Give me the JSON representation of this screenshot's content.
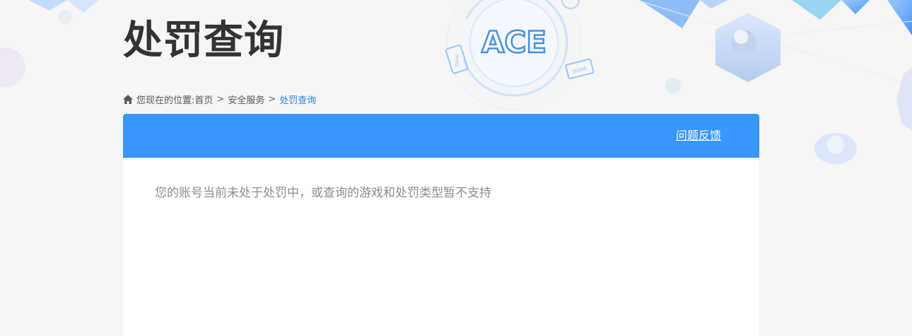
{
  "page": {
    "title": "处罚查询"
  },
  "breadcrumb": {
    "prefix": "您现在的位置:",
    "items": [
      "首页",
      "安全服务"
    ],
    "separator": ">",
    "current": "处罚查询",
    "icon": "home-icon"
  },
  "panel": {
    "feedback_label": "问题反馈",
    "message": "您的账号当前未处于处罚中，或查询的游戏和处罚类型暂不支持"
  },
  "decor": {
    "logo_text": "ACE",
    "device_label_phone": "GAME",
    "device_label_monitor": "GAME"
  },
  "colors": {
    "header_blue": "#3896fd",
    "link_blue": "#2b86d9",
    "title": "#333333",
    "message": "#8c8c8c",
    "background": "#f5f5f5"
  }
}
